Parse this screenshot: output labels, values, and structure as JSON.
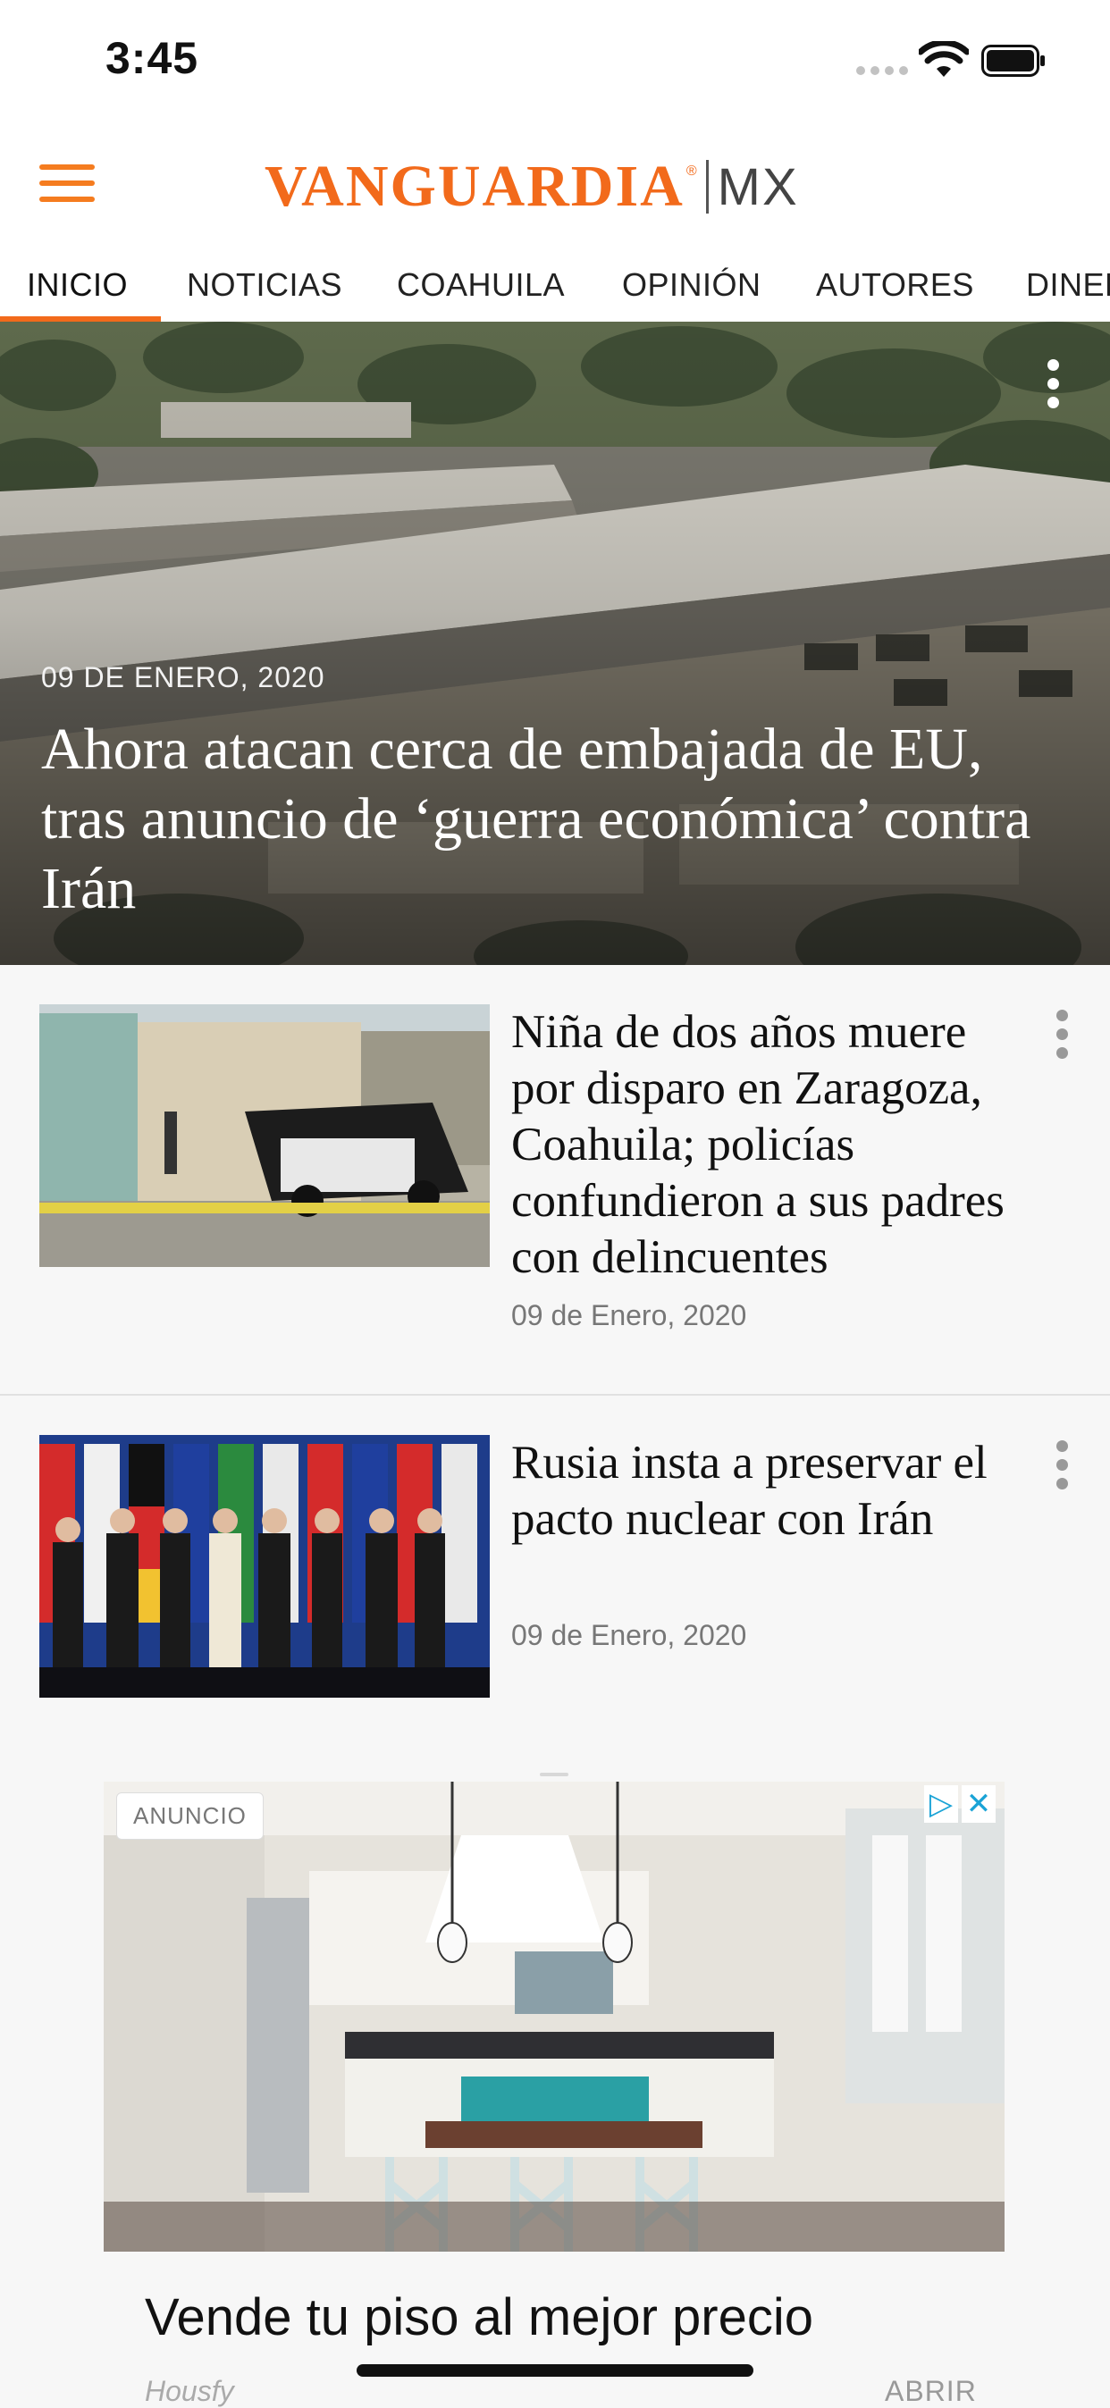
{
  "status_bar": {
    "time": "3:45"
  },
  "header": {
    "logo_main": "VANGUARDIA",
    "logo_reg": "®",
    "logo_suffix": "MX",
    "brand_color": "#f26a1b"
  },
  "tabs": [
    {
      "label": "INICIO",
      "active": true
    },
    {
      "label": "NOTICIAS"
    },
    {
      "label": "COAHUILA"
    },
    {
      "label": "OPINIÓN"
    },
    {
      "label": "AUTORES"
    },
    {
      "label": "DINERO"
    }
  ],
  "hero": {
    "date": "09 DE ENERO, 2020",
    "title": "Ahora atacan cerca de embajada de EU, tras anuncio de ‘guerra económica’ contra Irán"
  },
  "articles": [
    {
      "title": "Niña de dos años muere por disparo en Zaragoza, Coahuila; policías confundieron a sus padres con delincuentes",
      "date": "09 de Enero, 2020"
    },
    {
      "title": "Rusia insta a preservar el pacto nuclear con Irán",
      "date": "09 de Enero, 2020"
    }
  ],
  "ad": {
    "badge": "ANUNCIO",
    "headline": "Vende tu piso al mejor precio",
    "source": "Housfy",
    "cta": "ABRIR"
  },
  "icons": [
    "menu-icon",
    "more-vertical-icon",
    "wifi-icon",
    "battery-icon",
    "adchoices-icon",
    "close-icon"
  ]
}
